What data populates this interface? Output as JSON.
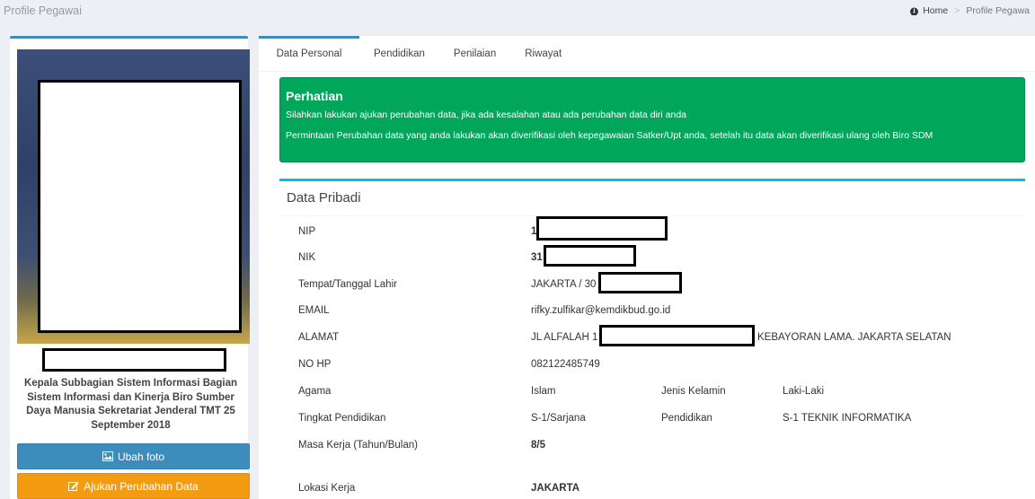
{
  "header": {
    "page_title": "Profile Pegawai",
    "breadcrumb": {
      "home": "Home",
      "current": "Profile Pegawa"
    }
  },
  "profile": {
    "job_title": "Kepala Subbagian Sistem Informasi Bagian Sistem Informasi dan Kinerja Biro Sumber Daya Manusia Sekretariat Jenderal TMT 25 September 2018",
    "buttons": {
      "photo": "Ubah foto",
      "edit": "Ajukan Perubahan Data"
    },
    "colors": {
      "photo_button": "#3c8dbc",
      "edit_button": "#f39c12"
    }
  },
  "tabs": [
    {
      "label": "Data Personal",
      "active": true
    },
    {
      "label": "Pendidikan",
      "active": false
    },
    {
      "label": "Penilaian",
      "active": false
    },
    {
      "label": "Riwayat",
      "active": false
    }
  ],
  "alert": {
    "title": "Perhatian",
    "line1": "Silahkan lakukan ajukan perubahan data, jika ada kesalahan atau ada perubahan data diri anda",
    "line2": "Permintaan Perubahan data yang anda lakukan akan diverifikasi oleh kepegawaian Satker/Upt anda, setelah itu data akan diverifikasi ulang oleh Biro SDM",
    "color": "#00a65a"
  },
  "data_pribadi": {
    "title": "Data Pribadi",
    "nip": {
      "label": "NIP",
      "value": "1"
    },
    "nik": {
      "label": "NIK",
      "value": "31"
    },
    "ttl": {
      "label": "Tempat/Tanggal Lahir",
      "value": "JAKARTA / 30"
    },
    "email": {
      "label": "EMAIL",
      "value": "rifky.zulfikar@kemdikbud.go.id"
    },
    "alamat": {
      "label": "ALAMAT",
      "value": "JL ALFALAH 1",
      "value_tail": "KEBAYORAN LAMA. JAKARTA SELATAN"
    },
    "nohp": {
      "label": "NO HP",
      "value": "082122485749"
    },
    "agama": {
      "label": "Agama",
      "value": "Islam",
      "label2": "Jenis Kelamin",
      "value2": "Laki-Laki"
    },
    "pendidikan": {
      "label": "Tingkat Pendidikan",
      "value": "S-1/Sarjana",
      "label2": "Pendidikan",
      "value2": "S-1 TEKNIK INFORMATIKA"
    },
    "masa_kerja": {
      "label": "Masa Kerja (Tahun/Bulan)",
      "value": "8/5"
    },
    "lokasi": {
      "label": "Lokasi Kerja",
      "value": "JAKARTA"
    }
  }
}
